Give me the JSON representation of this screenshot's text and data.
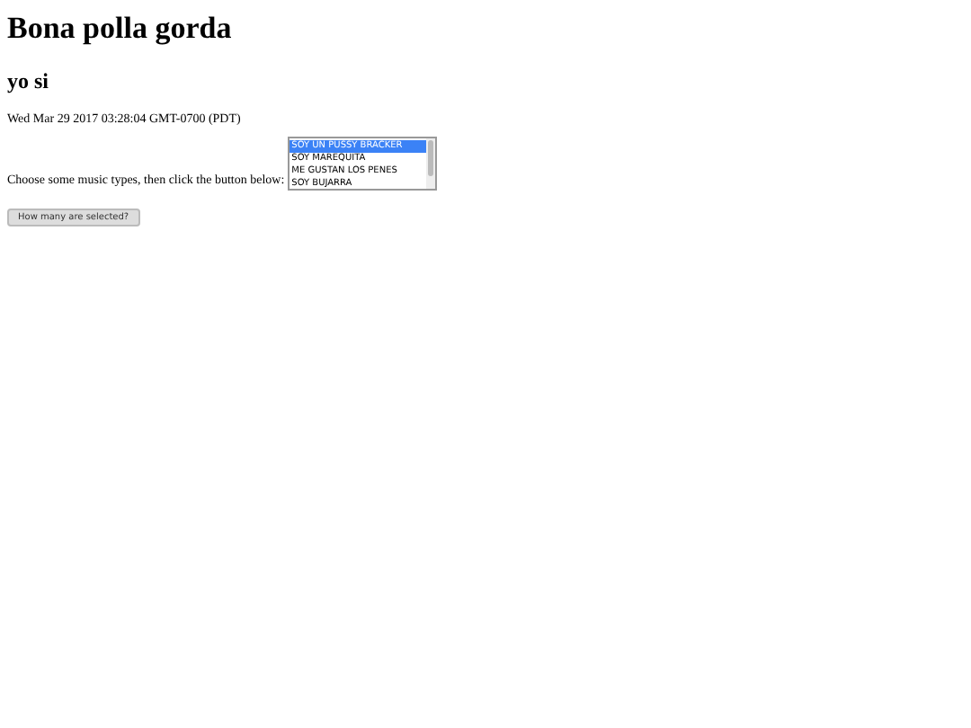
{
  "heading": "Bona polla gorda",
  "subheading": "yo si",
  "date": "Wed Mar 29 2017 03:28:04 GMT-0700 (PDT)",
  "prompt": "Choose some music types, then click the button below:",
  "options": [
    {
      "label": "SOY UN PUSSY BRACKER",
      "selected": true
    },
    {
      "label": "SOY MAREQUITA",
      "selected": false
    },
    {
      "label": "ME GUSTAN LOS PENES",
      "selected": false
    },
    {
      "label": "SOY BUJARRA",
      "selected": false
    }
  ],
  "button": "How many are selected?"
}
